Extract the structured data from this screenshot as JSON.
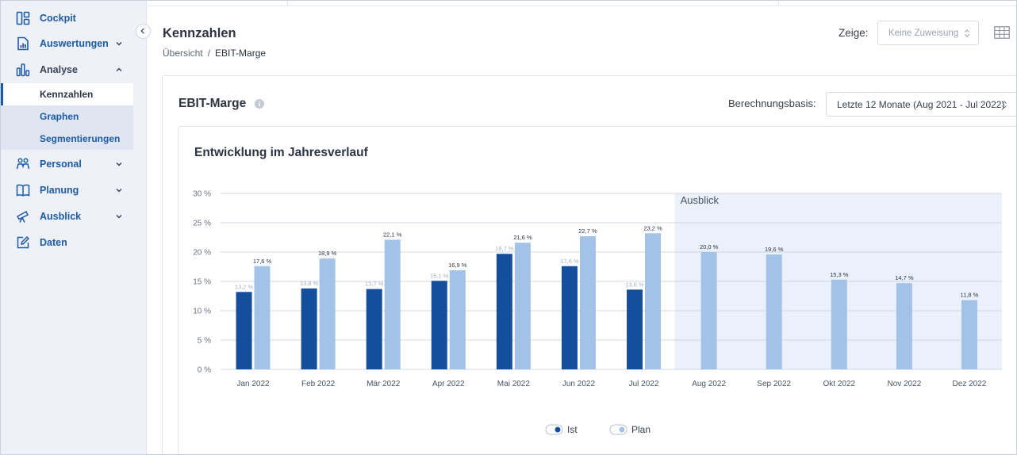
{
  "sidebar": {
    "items": [
      {
        "label": "Cockpit",
        "icon": "dashboard-icon",
        "chevron": ""
      },
      {
        "label": "Auswertungen",
        "icon": "report-icon",
        "chevron": "down"
      },
      {
        "label": "Analyse",
        "icon": "bar-chart-icon",
        "chevron": "up"
      },
      {
        "label": "Personal",
        "icon": "people-icon",
        "chevron": "down"
      },
      {
        "label": "Planung",
        "icon": "book-icon",
        "chevron": "down"
      },
      {
        "label": "Ausblick",
        "icon": "telescope-icon",
        "chevron": "down"
      },
      {
        "label": "Daten",
        "icon": "edit-icon",
        "chevron": ""
      }
    ],
    "subitems": [
      {
        "label": "Kennzahlen",
        "active": true
      },
      {
        "label": "Graphen",
        "active": false
      },
      {
        "label": "Segmentierungen",
        "active": false
      }
    ]
  },
  "header": {
    "title": "Kennzahlen",
    "breadcrumb": {
      "parent": "Übersicht",
      "separator": "/",
      "current": "EBIT-Marge"
    },
    "zeige_label": "Zeige:",
    "zeige_value": "Keine Zuweisung"
  },
  "card": {
    "title": "EBIT-Marge",
    "basis_label": "Berechnungsbasis:",
    "basis_value": "Letzte 12 Monate (Aug 2021 - Jul 2022)"
  },
  "colors": {
    "accent": "#1c5aa6",
    "ist": "#154f9c",
    "plan": "#a3c2e8",
    "outlook_bg": "#eaf1fa"
  },
  "chart_data": {
    "type": "bar",
    "title": "Entwicklung im Jahresverlauf",
    "categories": [
      "Jan 2022",
      "Feb 2022",
      "Mär 2022",
      "Apr 2022",
      "Mai 2022",
      "Jun 2022",
      "Jul 2022",
      "Aug 2022",
      "Sep 2022",
      "Okt 2022",
      "Nov 2022",
      "Dez 2022"
    ],
    "series": [
      {
        "name": "Ist",
        "values": [
          13.2,
          13.8,
          13.7,
          15.1,
          19.7,
          17.6,
          13.6,
          null,
          null,
          null,
          null,
          null
        ],
        "labels": [
          "13,2 %",
          "13,8 %",
          "13,7 %",
          "15,1 %",
          "19,7 %",
          "17,6 %",
          "13,6 %",
          "",
          "",
          "",
          "",
          ""
        ]
      },
      {
        "name": "Plan",
        "values": [
          17.6,
          18.9,
          22.1,
          16.9,
          21.6,
          22.7,
          23.2,
          20.0,
          19.6,
          15.3,
          14.7,
          11.8
        ],
        "labels": [
          "17,6 %",
          "18,9 %",
          "22,1 %",
          "16,9 %",
          "21,6 %",
          "22,7 %",
          "23,2 %",
          "20,0 %",
          "19,6 %",
          "15,3 %",
          "14,7 %",
          "11,8 %"
        ]
      }
    ],
    "yticks": [
      0,
      5,
      10,
      15,
      20,
      25,
      30
    ],
    "ytick_labels": [
      "0 %",
      "5 %",
      "10 %",
      "15 %",
      "20 %",
      "25 %",
      "30 %"
    ],
    "ylim": [
      0,
      30
    ],
    "outlook_label": "Ausblick",
    "outlook_start_index": 7,
    "legend": [
      {
        "label": "Ist"
      },
      {
        "label": "Plan"
      }
    ],
    "legend_position": "bottom",
    "grid": true
  }
}
